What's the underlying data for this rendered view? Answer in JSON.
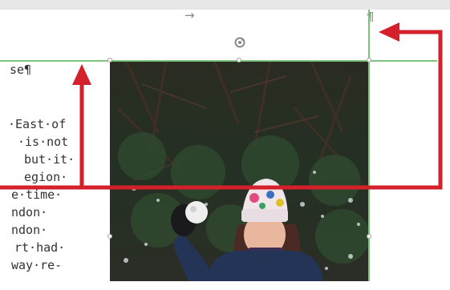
{
  "text_lines": [
    "se¶",
    "",
    "",
    "·East·of",
    "·is·not",
    "but·it·",
    "egion·",
    "e·time·",
    "ndon·",
    "ndon·",
    "rt·had·",
    "way·re-"
  ],
  "formatting_marks": {
    "tab_arrow": "→",
    "paragraph_mark": "¶"
  },
  "icons": {
    "rotate_handle": "rotate-icon",
    "annotation_arrows": "red-arrow-icon"
  },
  "colors": {
    "selection_border": "#7dc37d",
    "annotation": "#d3202a",
    "text": "#333333",
    "marks": "#8a8a8a",
    "hat": "#f1e7ea",
    "jacket": "#233456"
  }
}
